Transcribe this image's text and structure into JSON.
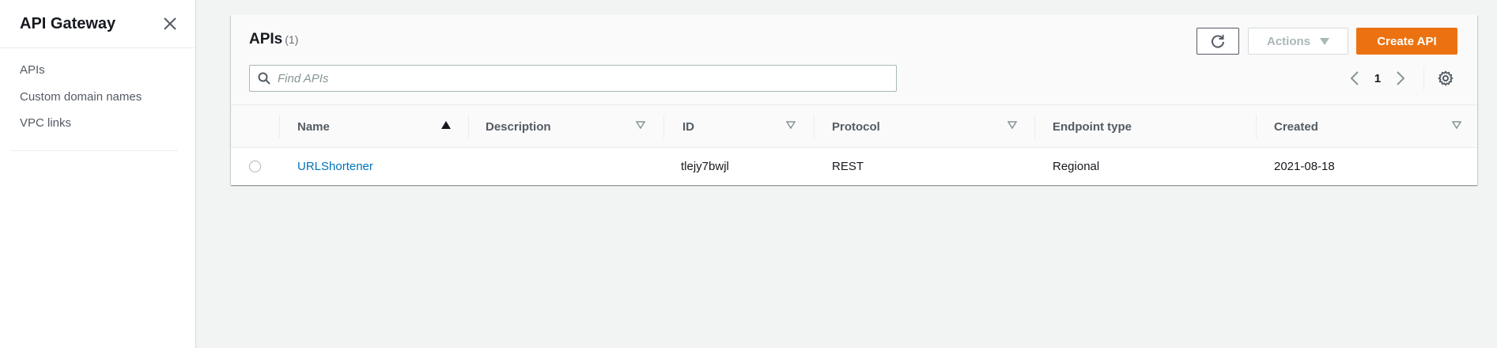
{
  "sidebar": {
    "title": "API Gateway",
    "items": [
      {
        "label": "APIs"
      },
      {
        "label": "Custom domain names"
      },
      {
        "label": "VPC links"
      }
    ]
  },
  "panel": {
    "title": "APIs",
    "count": "(1)",
    "refresh_icon": "refresh-icon",
    "actions_label": "Actions",
    "create_label": "Create API",
    "search_placeholder": "Find APIs",
    "search_value": "",
    "page_number": "1",
    "colors": {
      "accent": "#ec7211",
      "link": "#0073bb"
    }
  },
  "table": {
    "columns": [
      {
        "label": "Name",
        "sort": "ascending"
      },
      {
        "label": "Description"
      },
      {
        "label": "ID"
      },
      {
        "label": "Protocol"
      },
      {
        "label": "Endpoint type"
      },
      {
        "label": "Created"
      }
    ],
    "rows": [
      {
        "name": "URLShortener",
        "description": "",
        "id": "tlejy7bwjl",
        "protocol": "REST",
        "endpoint_type": "Regional",
        "created": "2021-08-18"
      }
    ]
  }
}
